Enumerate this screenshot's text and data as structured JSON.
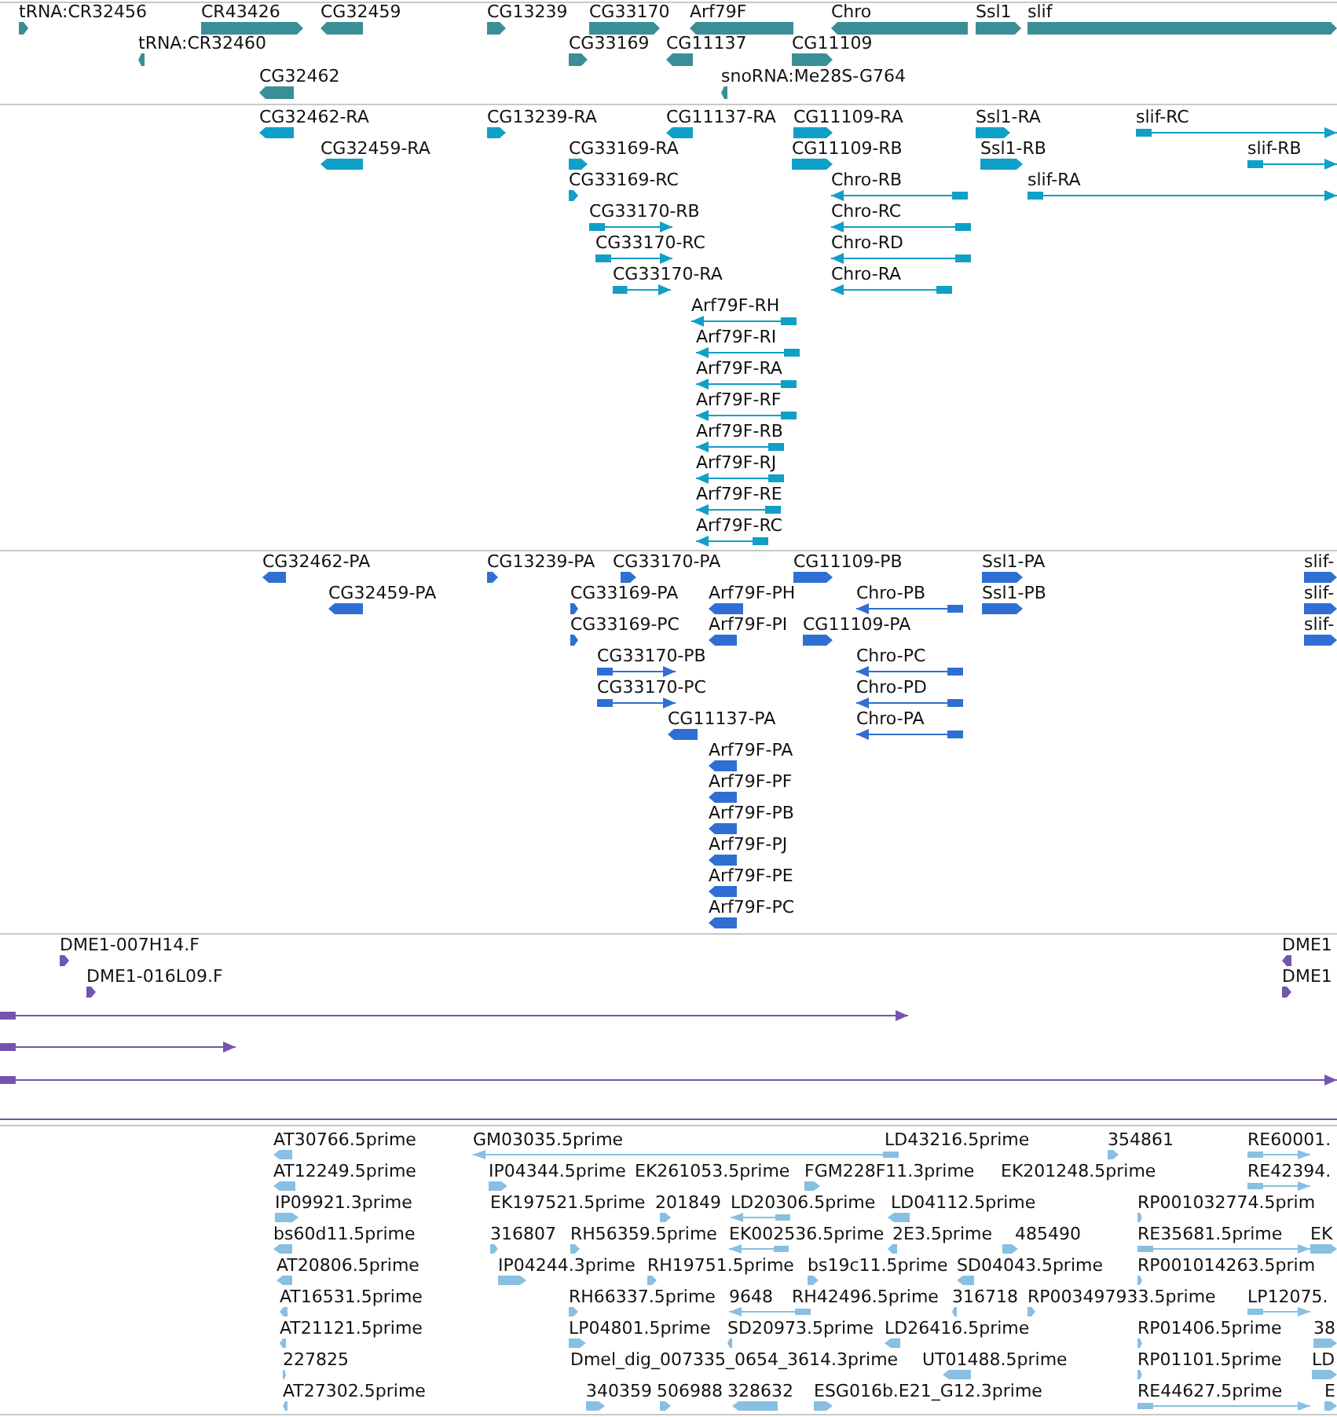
{
  "tracks": [
    {
      "kind": "gene",
      "features": [
        {
          "label": "tRNA:CR32456",
          "reverse": false
        },
        {
          "label": "CR43426",
          "reverse": false
        },
        {
          "label": "CG32459",
          "reverse": true
        },
        {
          "label": "CG13239",
          "reverse": false
        },
        {
          "label": "CG33170",
          "reverse": false
        },
        {
          "label": "Arf79F",
          "reverse": true
        },
        {
          "label": "Chro",
          "reverse": true
        },
        {
          "label": "Ssl1",
          "reverse": false
        },
        {
          "label": "slif",
          "reverse": false
        },
        {
          "label": "tRNA:CR32460",
          "reverse": true
        },
        {
          "label": "CG33169",
          "reverse": false
        },
        {
          "label": "CG11137",
          "reverse": true
        },
        {
          "label": "CG11109",
          "reverse": false
        },
        {
          "label": "CG32462",
          "reverse": true
        },
        {
          "label": "snoRNA:Me28S-G764",
          "reverse": true
        }
      ]
    },
    {
      "kind": "transcript",
      "features": [
        {
          "label": "CG32462-RA",
          "reverse": true
        },
        {
          "label": "CG13239-RA",
          "reverse": false
        },
        {
          "label": "CG11137-RA",
          "reverse": true
        },
        {
          "label": "CG11109-RA",
          "reverse": false
        },
        {
          "label": "Ssl1-RA",
          "reverse": false
        },
        {
          "label": "slif-RC",
          "reverse": false
        },
        {
          "label": "CG32459-RA",
          "reverse": true
        },
        {
          "label": "CG33169-RA",
          "reverse": false
        },
        {
          "label": "CG11109-RB",
          "reverse": false
        },
        {
          "label": "Ssl1-RB",
          "reverse": false
        },
        {
          "label": "slif-RB",
          "reverse": false
        },
        {
          "label": "CG33169-RC",
          "reverse": false
        },
        {
          "label": "Chro-RB",
          "reverse": true
        },
        {
          "label": "slif-RA",
          "reverse": false
        },
        {
          "label": "CG33170-RB",
          "reverse": false
        },
        {
          "label": "Chro-RC",
          "reverse": true
        },
        {
          "label": "CG33170-RC",
          "reverse": false
        },
        {
          "label": "Chro-RD",
          "reverse": true
        },
        {
          "label": "CG33170-RA",
          "reverse": false
        },
        {
          "label": "Chro-RA",
          "reverse": true
        },
        {
          "label": "Arf79F-RH",
          "reverse": true
        },
        {
          "label": "Arf79F-RI",
          "reverse": true
        },
        {
          "label": "Arf79F-RA",
          "reverse": true
        },
        {
          "label": "Arf79F-RF",
          "reverse": true
        },
        {
          "label": "Arf79F-RB",
          "reverse": true
        },
        {
          "label": "Arf79F-RJ",
          "reverse": true
        },
        {
          "label": "Arf79F-RE",
          "reverse": true
        },
        {
          "label": "Arf79F-RC",
          "reverse": true
        }
      ]
    },
    {
      "kind": "protein",
      "features": [
        {
          "label": "CG32462-PA",
          "reverse": true
        },
        {
          "label": "CG13239-PA",
          "reverse": false
        },
        {
          "label": "CG33170-PA",
          "reverse": false
        },
        {
          "label": "CG11109-PB",
          "reverse": false
        },
        {
          "label": "Ssl1-PA",
          "reverse": false
        },
        {
          "label": "slif-",
          "reverse": false
        },
        {
          "label": "CG32459-PA",
          "reverse": true
        },
        {
          "label": "CG33169-PA",
          "reverse": false
        },
        {
          "label": "Arf79F-PH",
          "reverse": true
        },
        {
          "label": "Chro-PB",
          "reverse": true
        },
        {
          "label": "Ssl1-PB",
          "reverse": false
        },
        {
          "label": "slif-",
          "reverse": false
        },
        {
          "label": "CG33169-PC",
          "reverse": false
        },
        {
          "label": "Arf79F-PI",
          "reverse": true
        },
        {
          "label": "CG11109-PA",
          "reverse": false
        },
        {
          "label": "slif-",
          "reverse": false
        },
        {
          "label": "CG33170-PB",
          "reverse": false
        },
        {
          "label": "Chro-PC",
          "reverse": true
        },
        {
          "label": "CG33170-PC",
          "reverse": false
        },
        {
          "label": "Chro-PD",
          "reverse": true
        },
        {
          "label": "CG11137-PA",
          "reverse": true
        },
        {
          "label": "Chro-PA",
          "reverse": true
        },
        {
          "label": "Arf79F-PA",
          "reverse": true
        },
        {
          "label": "Arf79F-PF",
          "reverse": true
        },
        {
          "label": "Arf79F-PB",
          "reverse": true
        },
        {
          "label": "Arf79F-PJ",
          "reverse": true
        },
        {
          "label": "Arf79F-PE",
          "reverse": true
        },
        {
          "label": "Arf79F-PC",
          "reverse": true
        }
      ]
    },
    {
      "kind": "clone",
      "features": [
        {
          "label": "DME1-007H14.F",
          "reverse": false
        },
        {
          "label": "DME1",
          "reverse": true
        },
        {
          "label": "DME1-016L09.F",
          "reverse": false
        },
        {
          "label": "DME1",
          "reverse": false
        },
        {
          "reverse": false
        },
        {
          "reverse": false
        },
        {
          "reverse": false
        }
      ]
    },
    {
      "kind": "est",
      "features": [
        {
          "label": "AT30766.5prime",
          "reverse": true
        },
        {
          "label": "GM03035.5prime",
          "reverse": true
        },
        {
          "label": "LD43216.5prime"
        },
        {
          "label": "354861",
          "reverse": false
        },
        {
          "label": "RE60001.",
          "reverse": false
        },
        {
          "label": "AT12249.5prime",
          "reverse": true
        },
        {
          "label": "IP04344.5prime",
          "reverse": false
        },
        {
          "label": "EK261053.5prime"
        },
        {
          "label": "FGM228F11.3prime",
          "reverse": false
        },
        {
          "label": "EK201248.5prime"
        },
        {
          "label": "RE42394.",
          "reverse": false
        },
        {
          "label": "IP09921.3prime",
          "reverse": false
        },
        {
          "label": "EK197521.5prime"
        },
        {
          "label": "201849",
          "reverse": false
        },
        {
          "label": "LD20306.5prime",
          "reverse": true
        },
        {
          "label": "LD04112.5prime",
          "reverse": true
        },
        {
          "label": "RP001032774.5prim",
          "reverse": false
        },
        {
          "label": "bs60d11.5prime",
          "reverse": true
        },
        {
          "label": "316807",
          "reverse": false
        },
        {
          "label": "RH56359.5prime",
          "reverse": false
        },
        {
          "label": "EK002536.5prime",
          "reverse": true
        },
        {
          "label": "2E3.5prime",
          "reverse": true
        },
        {
          "label": "485490",
          "reverse": false
        },
        {
          "label": "RE35681.5prime",
          "reverse": false
        },
        {
          "label": "EK",
          "reverse": false
        },
        {
          "label": "AT20806.5prime",
          "reverse": true
        },
        {
          "label": "IP04244.3prime",
          "reverse": false
        },
        {
          "label": "RH19751.5prime",
          "reverse": false
        },
        {
          "label": "bs19c11.5prime",
          "reverse": false
        },
        {
          "label": "SD04043.5prime",
          "reverse": true
        },
        {
          "label": "RP001014263.5prim",
          "reverse": false
        },
        {
          "label": "AT16531.5prime",
          "reverse": true
        },
        {
          "label": "RH66337.5prime",
          "reverse": false
        },
        {
          "label": "9648",
          "reverse": true
        },
        {
          "label": "RH42496.5prime"
        },
        {
          "label": "316718",
          "reverse": true
        },
        {
          "label": "RP003497933.5prime",
          "reverse": false
        },
        {
          "label": "LP12075.",
          "reverse": false
        },
        {
          "label": "AT21121.5prime",
          "reverse": true
        },
        {
          "label": "LP04801.5prime",
          "reverse": false
        },
        {
          "label": "SD20973.5prime",
          "reverse": true
        },
        {
          "label": "LD26416.5prime",
          "reverse": true
        },
        {
          "label": "RP01406.5prime",
          "reverse": false
        },
        {
          "label": "38",
          "reverse": false
        },
        {
          "label": "227825",
          "reverse": false
        },
        {
          "label": "Dmel_dig_007335_0654_3614.3prime"
        },
        {
          "label": "UT01488.5prime",
          "reverse": true
        },
        {
          "label": "RP01101.5prime",
          "reverse": false
        },
        {
          "label": "LD",
          "reverse": false
        },
        {
          "label": "AT27302.5prime",
          "reverse": true
        },
        {
          "label": "340359",
          "reverse": false
        },
        {
          "label": "506988",
          "reverse": false
        },
        {
          "label": "328632",
          "reverse": true
        },
        {
          "label": "ESG016b.E21_G12.3prime",
          "reverse": false
        },
        {
          "label": "RE44627.5prime",
          "reverse": false
        },
        {
          "label": "E",
          "reverse": false
        }
      ]
    }
  ]
}
